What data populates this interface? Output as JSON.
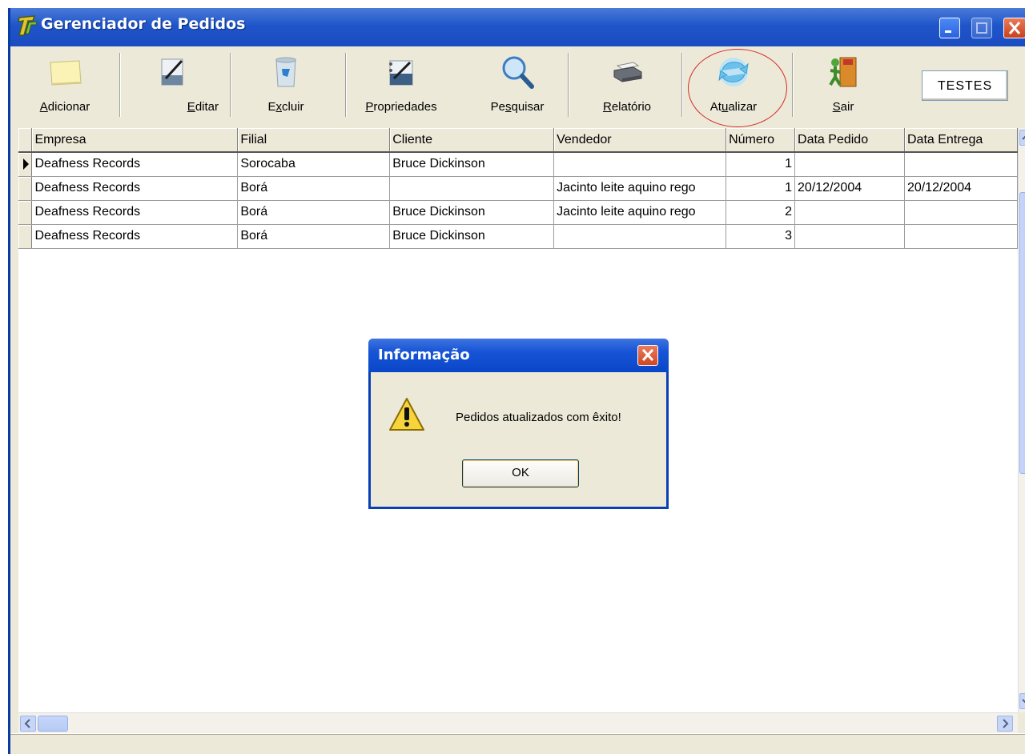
{
  "window": {
    "title": "Gerenciador de Pedidos"
  },
  "toolbar": {
    "add": {
      "pre": "",
      "key": "A",
      "post": "dicionar"
    },
    "edit": {
      "pre": "",
      "key": "E",
      "post": "ditar"
    },
    "delete": {
      "pre": "E",
      "key": "x",
      "post": "cluir"
    },
    "properties": {
      "pre": "",
      "key": "P",
      "post": "ropriedades"
    },
    "search": {
      "pre": "Pe",
      "key": "s",
      "post": "quisar"
    },
    "report": {
      "pre": "",
      "key": "R",
      "post": "elatório"
    },
    "refresh": {
      "pre": "At",
      "key": "u",
      "post": "alizar"
    },
    "exit": {
      "pre": "",
      "key": "S",
      "post": "air"
    },
    "tests_label": "TESTES"
  },
  "grid": {
    "columns": [
      "Empresa",
      "Filial",
      "Cliente",
      "Vendedor",
      "Número",
      "Data Pedido",
      "Data Entrega"
    ],
    "rows": [
      {
        "empresa": "Deafness Records",
        "filial": "Sorocaba",
        "cliente": "Bruce Dickinson",
        "vendedor": "",
        "numero": "1",
        "data_pedido": "",
        "data_entrega": ""
      },
      {
        "empresa": "Deafness Records",
        "filial": "Borá",
        "cliente": "",
        "vendedor": "Jacinto leite aquino rego",
        "numero": "1",
        "data_pedido": "20/12/2004",
        "data_entrega": "20/12/2004"
      },
      {
        "empresa": "Deafness Records",
        "filial": "Borá",
        "cliente": "Bruce Dickinson",
        "vendedor": "Jacinto leite aquino rego",
        "numero": "2",
        "data_pedido": "",
        "data_entrega": ""
      },
      {
        "empresa": "Deafness Records",
        "filial": "Borá",
        "cliente": "Bruce Dickinson",
        "vendedor": "",
        "numero": "3",
        "data_pedido": "",
        "data_entrega": ""
      }
    ]
  },
  "dialog": {
    "title": "Informação",
    "message": "Pedidos atualizados com êxito!",
    "ok_label": "OK"
  },
  "colors": {
    "title_bar": "#1f55c9",
    "highlight_circle": "#d42a2a",
    "face": "#ece9d8"
  }
}
